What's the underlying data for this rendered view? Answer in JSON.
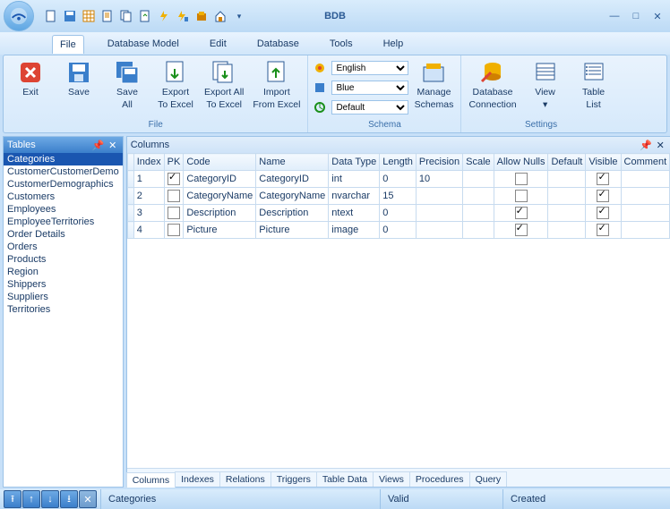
{
  "app_title": "BDB",
  "menus": [
    "File",
    "Database Model",
    "Edit",
    "Database",
    "Tools",
    "Help"
  ],
  "active_menu": 0,
  "ribbon": {
    "groups": [
      {
        "label": "File",
        "buttons": [
          {
            "name": "exit",
            "label": "Exit"
          },
          {
            "name": "save",
            "label": "Save"
          },
          {
            "name": "save-all",
            "label": "Save\nAll"
          },
          {
            "name": "export-excel",
            "label": "Export\nTo Excel"
          },
          {
            "name": "export-all-excel",
            "label": "Export All\nTo Excel"
          },
          {
            "name": "import-excel",
            "label": "Import\nFrom Excel"
          }
        ]
      },
      {
        "label": "Schema",
        "dropdowns": [
          {
            "name": "language",
            "value": "English"
          },
          {
            "name": "theme",
            "value": "Blue"
          },
          {
            "name": "profile",
            "value": "Default"
          }
        ],
        "buttons": [
          {
            "name": "manage-schemas",
            "label": "Manage\nSchemas"
          }
        ]
      },
      {
        "label": "Settings",
        "buttons": [
          {
            "name": "db-connection",
            "label": "Database\nConnection"
          },
          {
            "name": "view",
            "label": "View\n▾"
          },
          {
            "name": "table-list",
            "label": "Table\nList"
          }
        ]
      }
    ]
  },
  "tables_pane": {
    "title": "Tables",
    "items": [
      "Categories",
      "CustomerCustomerDemo",
      "CustomerDemographics",
      "Customers",
      "Employees",
      "EmployeeTerritories",
      "Order Details",
      "Orders",
      "Products",
      "Region",
      "Shippers",
      "Suppliers",
      "Territories"
    ],
    "selected": 0
  },
  "columns_pane": {
    "title": "Columns",
    "headers": [
      "Index",
      "PK",
      "Code",
      "Name",
      "Data Type",
      "Length",
      "Precision",
      "Scale",
      "Allow Nulls",
      "Default",
      "Visible",
      "Comment"
    ],
    "rows": [
      {
        "Index": "1",
        "PK": true,
        "Code": "CategoryID",
        "Name": "CategoryID",
        "DataType": "int",
        "Length": "0",
        "Precision": "10",
        "Scale": "",
        "AllowNulls": false,
        "Default": "",
        "Visible": true,
        "Comment": ""
      },
      {
        "Index": "2",
        "PK": false,
        "Code": "CategoryName",
        "Name": "CategoryName",
        "DataType": "nvarchar",
        "Length": "15",
        "Precision": "",
        "Scale": "",
        "AllowNulls": false,
        "Default": "",
        "Visible": true,
        "Comment": ""
      },
      {
        "Index": "3",
        "PK": false,
        "Code": "Description",
        "Name": "Description",
        "DataType": "ntext",
        "Length": "0",
        "Precision": "",
        "Scale": "",
        "AllowNulls": true,
        "Default": "",
        "Visible": true,
        "Comment": ""
      },
      {
        "Index": "4",
        "PK": false,
        "Code": "Picture",
        "Name": "Picture",
        "DataType": "image",
        "Length": "0",
        "Precision": "",
        "Scale": "",
        "AllowNulls": true,
        "Default": "",
        "Visible": true,
        "Comment": ""
      }
    ]
  },
  "bottom_tabs": [
    "Columns",
    "Indexes",
    "Relations",
    "Triggers",
    "Table Data",
    "Views",
    "Procedures",
    "Query"
  ],
  "bottom_tab_selected": 0,
  "status": {
    "current": "Categories",
    "valid": "Valid",
    "created": "Created"
  }
}
